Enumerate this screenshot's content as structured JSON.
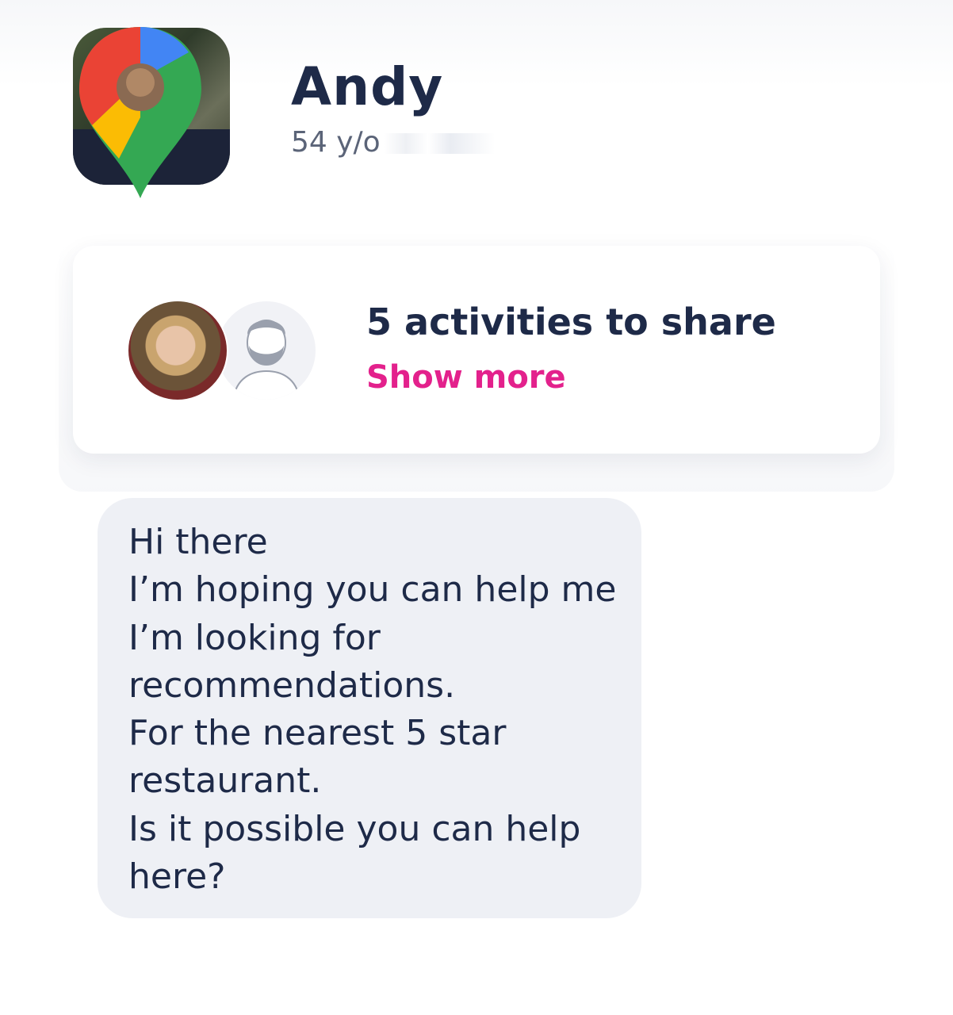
{
  "profile": {
    "name": "Andy",
    "age_label": "54 y/o"
  },
  "activities_card": {
    "title": "5 activities to share",
    "show_more_label": "Show more"
  },
  "message": {
    "text": "Hi there\nI’m hoping you can help me I’m looking for recommendations.\nFor the nearest 5 star restaurant.\nIs it possible you can help here?"
  },
  "colors": {
    "text_primary": "#1e2a48",
    "text_secondary": "#5b6478",
    "accent_pink": "#e3218c",
    "bubble_bg": "#eef0f5",
    "card_bg": "#ffffff"
  },
  "icons": {
    "profile_overlay": "map-pin-icon",
    "default_avatar": "bearded-man-avatar-icon"
  }
}
